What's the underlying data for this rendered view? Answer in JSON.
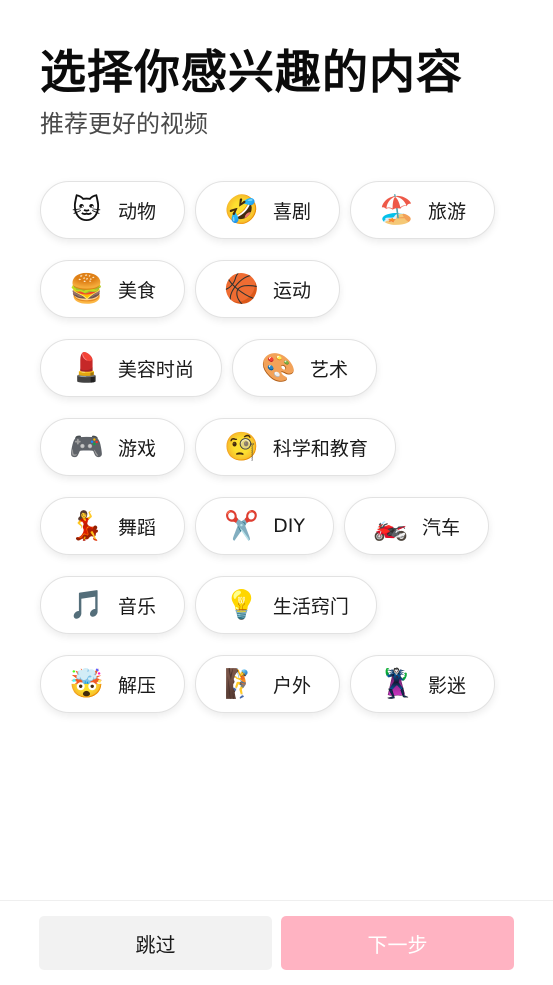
{
  "header": {
    "title": "选择你感兴趣的内容",
    "subtitle": "推荐更好的视频"
  },
  "interests": [
    [
      {
        "emoji": "🐱",
        "icon": "cat-face-icon",
        "label": "动物"
      },
      {
        "emoji": "🤣",
        "icon": "laughing-face-icon",
        "label": "喜剧"
      },
      {
        "emoji": "🏖️",
        "icon": "beach-umbrella-icon",
        "label": "旅游"
      }
    ],
    [
      {
        "emoji": "🍔",
        "icon": "hamburger-icon",
        "label": "美食"
      },
      {
        "emoji": "🏀",
        "icon": "basketball-icon",
        "label": "运动"
      }
    ],
    [
      {
        "emoji": "💄",
        "icon": "lipstick-icon",
        "label": "美容时尚"
      },
      {
        "emoji": "🎨",
        "icon": "palette-icon",
        "label": "艺术"
      }
    ],
    [
      {
        "emoji": "🎮",
        "icon": "game-controller-icon",
        "label": "游戏"
      },
      {
        "emoji": "🧐",
        "icon": "monocle-face-icon",
        "label": "科学和教育"
      }
    ],
    [
      {
        "emoji": "💃",
        "icon": "dancer-icon",
        "label": "舞蹈"
      },
      {
        "emoji": "✂️",
        "icon": "scissors-icon",
        "label": "DIY"
      },
      {
        "emoji": "🏍️",
        "icon": "motorcycle-icon",
        "label": "汽车"
      }
    ],
    [
      {
        "emoji": "🎵",
        "icon": "music-note-icon",
        "label": "音乐"
      },
      {
        "emoji": "💡",
        "icon": "light-bulb-icon",
        "label": "生活窍门"
      }
    ],
    [
      {
        "emoji": "🤯",
        "icon": "exploding-head-icon",
        "label": "解压"
      },
      {
        "emoji": "🧗",
        "icon": "climber-icon",
        "label": "户外"
      },
      {
        "emoji": "🦹",
        "icon": "supervillain-icon",
        "label": "影迷"
      }
    ]
  ],
  "footer": {
    "skip_label": "跳过",
    "next_label": "下一步"
  },
  "colors": {
    "next_button_bg": "#ffb3c2",
    "skip_button_bg": "#f2f2f2"
  }
}
